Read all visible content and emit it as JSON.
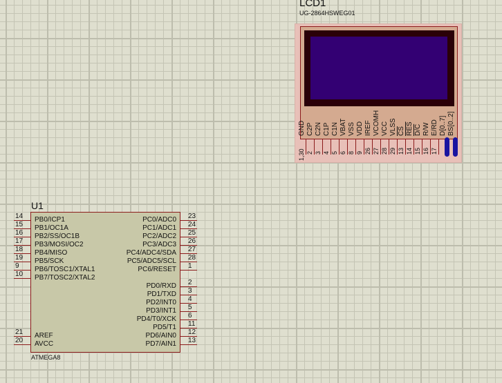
{
  "lcd": {
    "ref": "LCD1",
    "part": "UG-2864HSWEG01",
    "colors": {
      "body": "#d4aa90",
      "frame": "#e8c0b8",
      "bezel": "#2a0008",
      "screen": "#330073",
      "bus": "#1a14a0"
    },
    "pins": [
      {
        "label": "GND",
        "num": "1,30"
      },
      {
        "label": "C2P",
        "num": "2"
      },
      {
        "label": "C2N",
        "num": "3"
      },
      {
        "label": "C1P",
        "num": "4"
      },
      {
        "label": "C1N",
        "num": "5"
      },
      {
        "label": "VBAT",
        "num": "6"
      },
      {
        "label": "VSS",
        "num": "8"
      },
      {
        "label": "VDD",
        "num": "9"
      },
      {
        "label": "IREF",
        "num": "26"
      },
      {
        "label": "VCOMH",
        "num": "27"
      },
      {
        "label": "VCC",
        "num": "28"
      },
      {
        "label": "VLSS",
        "num": "29"
      },
      {
        "label": "CS",
        "num": "13",
        "bar": true
      },
      {
        "label": "RES",
        "num": "14",
        "bar": true
      },
      {
        "label": "D/C",
        "num": "15",
        "bar": true
      },
      {
        "label": "R/W",
        "num": "16"
      },
      {
        "label": "E/RD",
        "num": "17"
      }
    ],
    "bus_pins": [
      "D[0..7]",
      "BS[0..2]"
    ]
  },
  "mcu": {
    "ref": "U1",
    "part": "ATMEGA8",
    "color": "#c8c8a8",
    "left_pins": [
      {
        "label": "PB0/ICP1",
        "num": "14"
      },
      {
        "label": "PB1/OC1A",
        "num": "15"
      },
      {
        "label": "PB2/SS/OC1B",
        "num": "16"
      },
      {
        "label": "PB3/MOSI/OC2",
        "num": "17"
      },
      {
        "label": "PB4/MISO",
        "num": "18"
      },
      {
        "label": "PB5/SCK",
        "num": "19"
      },
      {
        "label": "PB6/TOSC1/XTAL1",
        "num": "9"
      },
      {
        "label": "PB7/TOSC2/XTAL2",
        "num": "10"
      }
    ],
    "left_bottom_pins": [
      {
        "label": "AREF",
        "num": "21"
      },
      {
        "label": "AVCC",
        "num": "20"
      }
    ],
    "right_pins": [
      {
        "label": "PC0/ADC0",
        "num": "23"
      },
      {
        "label": "PC1/ADC1",
        "num": "24"
      },
      {
        "label": "PC2/ADC2",
        "num": "25"
      },
      {
        "label": "PC3/ADC3",
        "num": "26"
      },
      {
        "label": "PC4/ADC4/SDA",
        "num": "27"
      },
      {
        "label": "PC5/ADC5/SCL",
        "num": "28"
      },
      {
        "label": "PC6/RESET",
        "num": "1"
      }
    ],
    "right_bottom_pins": [
      {
        "label": "PD0/RXD",
        "num": "2"
      },
      {
        "label": "PD1/TXD",
        "num": "3"
      },
      {
        "label": "PD2/INT0",
        "num": "4"
      },
      {
        "label": "PD3/INT1",
        "num": "5"
      },
      {
        "label": "PD4/T0/XCK",
        "num": "6"
      },
      {
        "label": "PD5/T1",
        "num": "11"
      },
      {
        "label": "PD6/AIN0",
        "num": "12"
      },
      {
        "label": "PD7/AIN1",
        "num": "13"
      }
    ]
  }
}
